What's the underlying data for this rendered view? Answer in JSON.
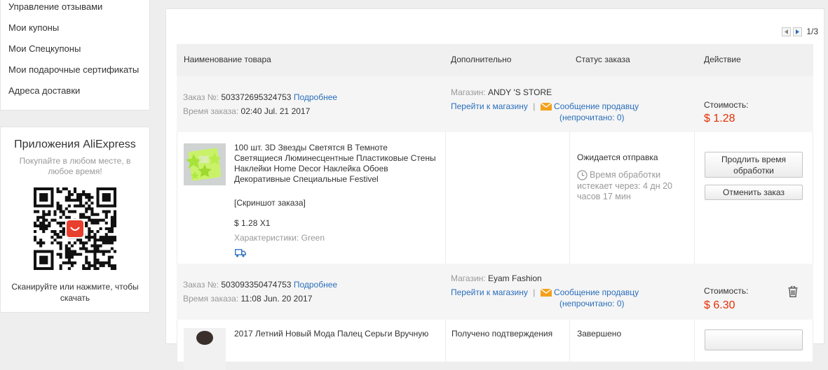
{
  "sidebar": {
    "menu": [
      "Управление отзывами",
      "Мои купоны",
      "Мои Спецкупоны",
      "Мои подарочные сертификаты",
      "Адреса доставки"
    ]
  },
  "apps": {
    "title": "Приложения AliExpress",
    "subtitle": "Покупайте в любом месте, в любое время!",
    "scan_text": "Сканируйте или нажмите, чтобы скачать"
  },
  "pager": {
    "text": "1/3"
  },
  "table": {
    "headers": [
      "Наименование товара",
      "Дополнительно",
      "Статус заказа",
      "Действие"
    ]
  },
  "orders": [
    {
      "order_label": "Заказ №:",
      "order_no": "503372695324753",
      "details_link": "Подробнее",
      "time_label": "Время заказа:",
      "time": "02:40 Jul. 21 2017",
      "store_label": "Магазин:",
      "store": "ANDY 'S STORE",
      "goto_store": "Перейти к магазину",
      "separator": "|",
      "message_link": "Сообщение продавцу",
      "unread": "(непрочитано: 0)",
      "cost_label": "Стоимость:",
      "cost": "$ 1.28",
      "product_title": "100 шт. 3D Звезды Светятся В Темноте Светящиеся Люминесцентные Пластиковые Стены Наклейки Home Decor Наклейка Обоев Декоративные Специальные Festivel",
      "snapshot": "[Скриншот заказа]",
      "price_qty": "$ 1.28 X1",
      "specs": "Характеристики: Green",
      "status": "Ожидается отправка",
      "processing_time": "Время обработки истекает через: 4 дн 20 часов 17 мин",
      "btn_extend": "Продлить время обработки",
      "btn_cancel": "Отменить заказ"
    },
    {
      "order_label": "Заказ №:",
      "order_no": "503093350474753",
      "details_link": "Подробнее",
      "time_label": "Время заказа:",
      "time": "11:08 Jun. 20 2017",
      "store_label": "Магазин:",
      "store": "Eyam Fashion",
      "goto_store": "Перейти к магазину",
      "separator": "|",
      "message_link": "Сообщение продавцу",
      "unread": "(непрочитано: 0)",
      "cost_label": "Стоимость:",
      "cost": "$ 6.30",
      "product_title": "2017 Летний Новый Мода Палец Серьги Вручную",
      "info_partial": "Получено подтверждения",
      "status_partial": "Завершено"
    }
  ],
  "colors": {
    "price": "#e62e04",
    "link": "#2a6ebb",
    "mail": "#f4a11d"
  },
  "icons": {
    "pager_prev": "triangle-left-icon",
    "pager_next": "triangle-right-icon",
    "mail": "envelope-icon",
    "clock": "clock-icon",
    "shipping": "truck-icon",
    "delete": "trash-icon",
    "app_logo": "aliexpress-logo-icon"
  }
}
